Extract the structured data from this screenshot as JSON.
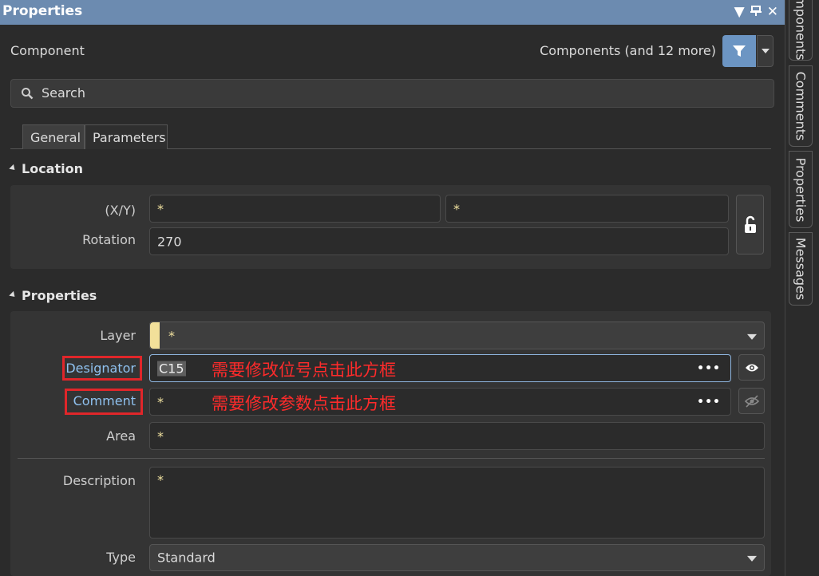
{
  "titlebar": {
    "title": "Properties"
  },
  "header": {
    "object_kind": "Component",
    "filter_text": "Components (and 12 more)"
  },
  "search": {
    "placeholder": "Search"
  },
  "tabs": [
    {
      "label": "General"
    },
    {
      "label": "Parameters"
    }
  ],
  "location": {
    "title": "Location",
    "xy_label": "(X/Y)",
    "x_value": "*",
    "y_value": "*",
    "rotation_label": "Rotation",
    "rotation_value": "270"
  },
  "properties": {
    "title": "Properties",
    "layer_label": "Layer",
    "layer_value": "*",
    "designator_label": "Designator",
    "designator_value": "C15",
    "designator_note": "需要修改位号点击此方框",
    "comment_label": "Comment",
    "comment_value": "*",
    "comment_note": "需要修改参数点击此方框",
    "area_label": "Area",
    "area_value": "*",
    "description_label": "Description",
    "description_value": "*",
    "type_label": "Type",
    "type_value": "Standard"
  },
  "side_tabs": [
    {
      "label": "Components"
    },
    {
      "label": "Comments"
    },
    {
      "label": "Properties"
    },
    {
      "label": "Messages"
    }
  ],
  "colors": {
    "title_bar": "#6c8bb0",
    "accent": "#6c95c3",
    "annotation": "#e0262a",
    "wildcard": "#f2e3a0"
  }
}
